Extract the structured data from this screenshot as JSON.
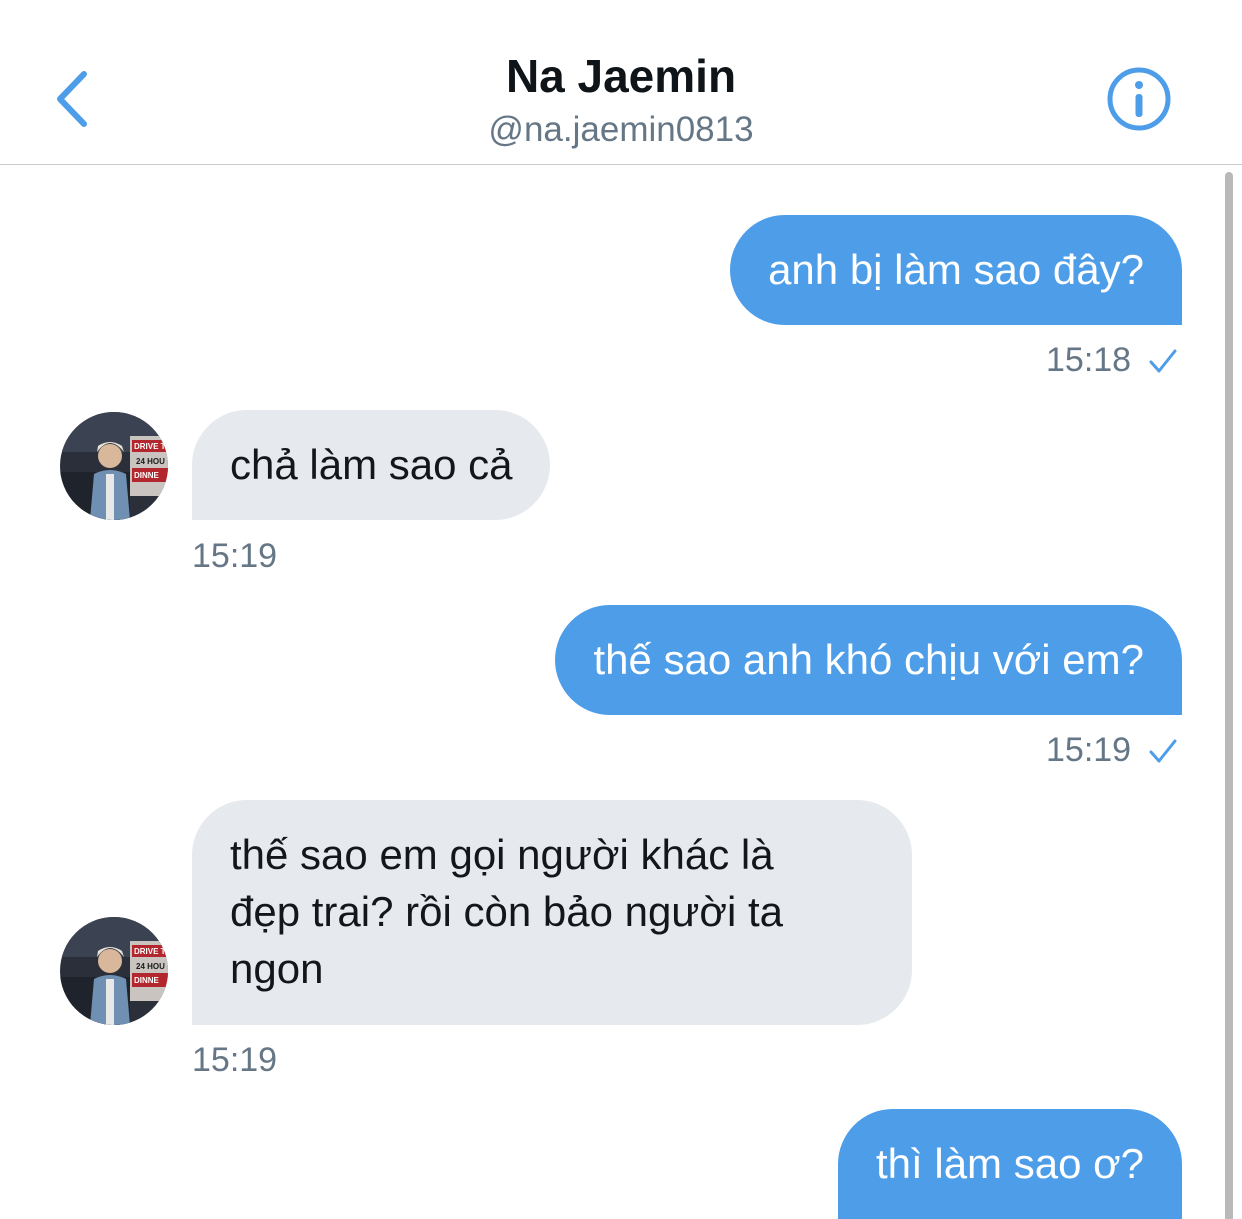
{
  "header": {
    "title": "Na Jaemin",
    "handle": "@na.jaemin0813",
    "back_icon": "chevron-left-icon",
    "info_icon": "info-circle-icon"
  },
  "colors": {
    "accent": "#4d9de9",
    "incoming_bubble": "#e6e9ee",
    "muted_text": "#657786"
  },
  "messages": [
    {
      "direction": "outgoing",
      "text": "anh bị làm sao đây?",
      "time": "15:18",
      "status_icon": "check-icon"
    },
    {
      "direction": "incoming",
      "text": "chả làm sao cả",
      "time": "15:19"
    },
    {
      "direction": "outgoing",
      "text": "thế sao anh khó chịu với em?",
      "time": "15:19",
      "status_icon": "check-icon"
    },
    {
      "direction": "incoming",
      "lines": [
        "thế sao em gọi người khác là",
        "đẹp trai? rồi còn bảo người ta",
        "ngon"
      ],
      "time": "15:19"
    },
    {
      "direction": "outgoing",
      "text": "thì làm sao ơ?"
    }
  ],
  "avatar_text": {
    "sign1": "DRIVE T",
    "sign2": "24 HOU",
    "sign3": "DINNE"
  }
}
